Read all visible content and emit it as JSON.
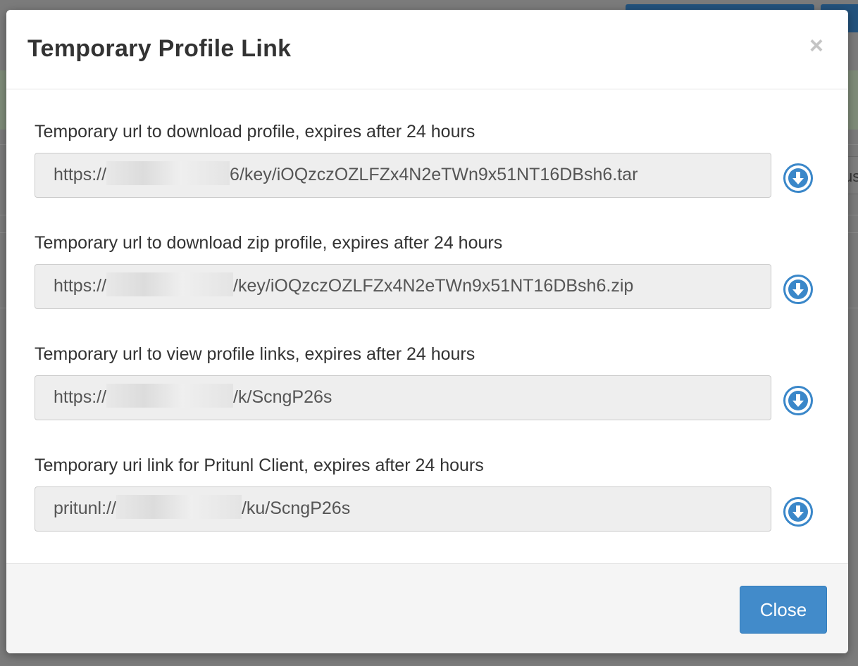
{
  "modal": {
    "title": "Temporary Profile Link",
    "close_symbol": "×",
    "close_button_label": "Close"
  },
  "fields": [
    {
      "label": "Temporary url to download profile, expires after 24 hours",
      "prefix": "https://",
      "suffix": "6/key/iOQzczOZLFZx4N2eTWn9x51NT16DBsh6.tar",
      "icon": "download-icon"
    },
    {
      "label": "Temporary url to download zip profile, expires after 24 hours",
      "prefix": "https://",
      "suffix": "/key/iOQzczOZLFZx4N2eTWn9x51NT16DBsh6.zip",
      "icon": "download-icon"
    },
    {
      "label": "Temporary url to view profile links, expires after 24 hours",
      "prefix": "https://",
      "suffix": "/k/ScngP26s",
      "icon": "download-icon"
    },
    {
      "label": "Temporary uri link for Pritunl Client, expires after 24 hours",
      "prefix": "pritunl://",
      "suffix": "/ku/ScngP26s",
      "icon": "download-icon"
    }
  ],
  "background": {
    "partial_text": "us"
  },
  "colors": {
    "primary": "#428bca",
    "icon": "#3a87c9"
  }
}
